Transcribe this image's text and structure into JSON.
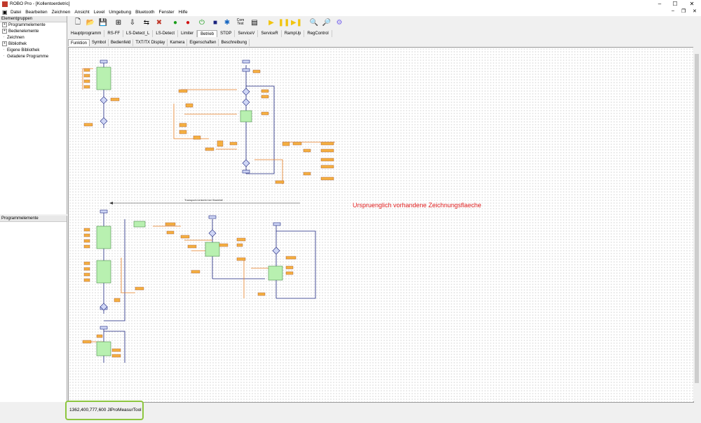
{
  "window": {
    "title": "ROBO Pro - [Kollentoerdetric]",
    "minimize": "–",
    "maximize": "☐",
    "close": "✕"
  },
  "menu": {
    "items": [
      "Datei",
      "Bearbeiten",
      "Zeichnen",
      "Ansicht",
      "Level",
      "Umgebung",
      "Bluetooth",
      "Fenster",
      "Hilfe"
    ]
  },
  "left_panel": {
    "header": "Elementgruppen",
    "items": [
      "Programmelemente",
      "Bedienelemente",
      "Zeichnen",
      "Bibliothek",
      "Eigene Bibliothek",
      "Geladene Programme"
    ],
    "lower_header": "Programmelemente"
  },
  "toolbar": {
    "icons": [
      "new-icon",
      "open-icon",
      "save-icon",
      "step-icon",
      "download-icon",
      "compare-icon",
      "delete-icon",
      "start-icon",
      "stop-icon",
      "online-icon",
      "com-usb-icon",
      "bluetooth-icon",
      "com-test-icon",
      "window-icon",
      "run-icon",
      "pause-icon",
      "step-run-icon",
      "zoom-out-icon",
      "zoom-in-icon",
      "debug-icon"
    ],
    "com_label": "Com Test"
  },
  "tabs": [
    "Hauptprogramm",
    "RS-FF",
    "LS-Detect_L",
    "LS-Detect",
    "Limiter",
    "Betrieb",
    "STOP",
    "ServiceV",
    "ServiceR",
    "RampUp",
    "RegControl"
  ],
  "active_tab": "Betrieb",
  "subtabs": [
    "Funktion",
    "Symbol",
    "Bedienfeld",
    "TXT/TX Display",
    "Kamera",
    "Eigenschaften",
    "Beschreibung"
  ],
  "active_subtab": "Funktion",
  "canvas": {
    "annotation": "Urspruenglich vorhandene Zeichnungsflaeche",
    "arrow_label": "Transport-Umkehr bei Stoerfall"
  },
  "statusbar": {
    "text": "1362,400,777,600 JlProMeasurTool"
  },
  "colors": {
    "accent_note": "#e02020",
    "status_border": "#8dc63f",
    "block_green": "#b8f0b0",
    "block_orange": "#f5b041",
    "line_blue": "#1a237e",
    "line_orange": "#e67e22"
  }
}
